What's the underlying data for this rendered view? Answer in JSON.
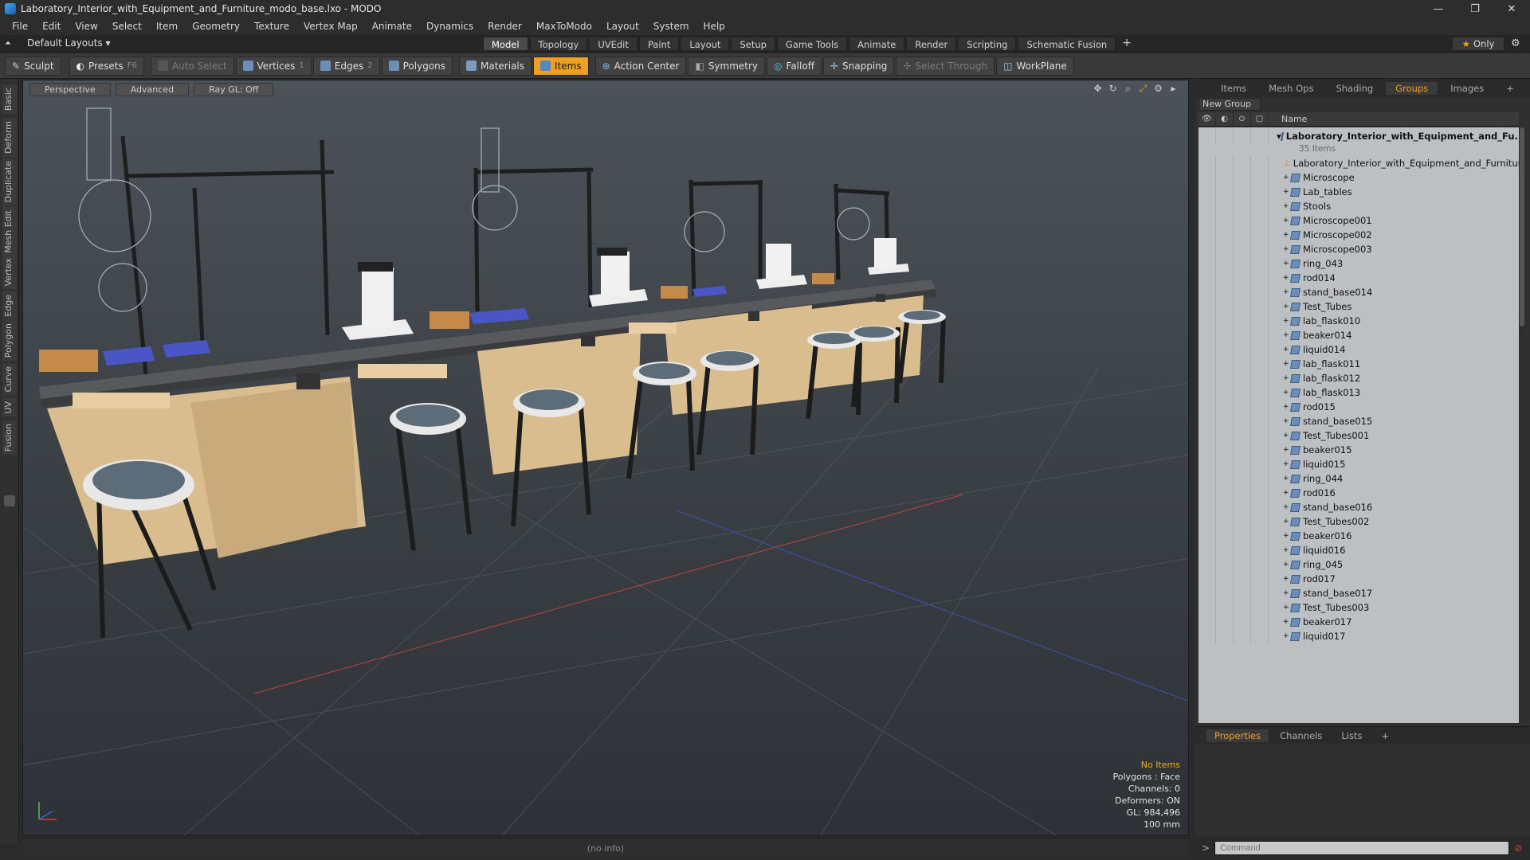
{
  "window": {
    "title": "Laboratory_Interior_with_Equipment_and_Furniture_modo_base.lxo - MODO",
    "minimize": "—",
    "restore": "❐",
    "close": "✕"
  },
  "menu": [
    "File",
    "Edit",
    "View",
    "Select",
    "Item",
    "Geometry",
    "Texture",
    "Vertex Map",
    "Animate",
    "Dynamics",
    "Render",
    "MaxToModo",
    "Layout",
    "System",
    "Help"
  ],
  "layout_bar": {
    "layout_name": "Default Layouts ▾",
    "tabs": [
      "Model",
      "Topology",
      "UVEdit",
      "Paint",
      "Layout",
      "Setup",
      "Game Tools",
      "Animate",
      "Render",
      "Scripting",
      "Schematic Fusion"
    ],
    "active_tab": "Model",
    "add_tab": "+",
    "only_label": "Only"
  },
  "toolbar": {
    "sculpt": "Sculpt",
    "presets": "Presets",
    "presets_key": "F6",
    "auto_select": "Auto Select",
    "vertices": "Vertices",
    "vertices_key": "1",
    "edges": "Edges",
    "edges_key": "2",
    "polygons": "Polygons",
    "materials": "Materials",
    "items": "Items",
    "action_center": "Action Center",
    "symmetry": "Symmetry",
    "falloff": "Falloff",
    "snapping": "Snapping",
    "select_through": "Select Through",
    "workplane": "WorkPlane"
  },
  "left_tabs": [
    "Basic",
    "Deform",
    "Duplicate",
    "Mesh Edit",
    "Vertex",
    "Edge",
    "Polygon",
    "Curve",
    "UV",
    "Fusion"
  ],
  "viewport": {
    "view_mode": "Perspective",
    "shading": "Advanced",
    "raygl": "Ray GL: Off",
    "stats": {
      "selection": "No Items",
      "polygons": "Polygons : Face",
      "channels": "Channels: 0",
      "deformers": "Deformers: ON",
      "gl": "GL: 984,496",
      "unit": "100 mm"
    }
  },
  "status_bar": {
    "info": "(no info)"
  },
  "right_panel": {
    "tabs": [
      "Items",
      "Mesh Ops",
      "Shading",
      "Groups",
      "Images"
    ],
    "active_tab": "Groups",
    "add_tab": "+",
    "new_group": "New Group",
    "name_header": "Name",
    "group": {
      "name": "Laboratory_Interior_with_Equipment_and_Fu...",
      "count": "35 Items"
    },
    "items": [
      "Laboratory_Interior_with_Equipment_and_Furniture",
      "Microscope",
      "Lab_tables",
      "Stools",
      "Microscope001",
      "Microscope002",
      "Microscope003",
      "ring_043",
      "rod014",
      "stand_base014",
      "Test_Tubes",
      "lab_flask010",
      "beaker014",
      "liquid014",
      "lab_flask011",
      "lab_flask012",
      "lab_flask013",
      "rod015",
      "stand_base015",
      "Test_Tubes001",
      "beaker015",
      "liquid015",
      "ring_044",
      "rod016",
      "stand_base016",
      "Test_Tubes002",
      "beaker016",
      "liquid016",
      "ring_045",
      "rod017",
      "stand_base017",
      "Test_Tubes003",
      "beaker017",
      "liquid017"
    ],
    "props_tabs": [
      "Properties",
      "Channels",
      "Lists"
    ],
    "props_active": "Properties",
    "command_placeholder": "Command"
  },
  "colors": {
    "accent": "#f0a020",
    "wood": "#d9bd8f",
    "countertop": "#4a4d50",
    "seat": "#5c6c78"
  }
}
